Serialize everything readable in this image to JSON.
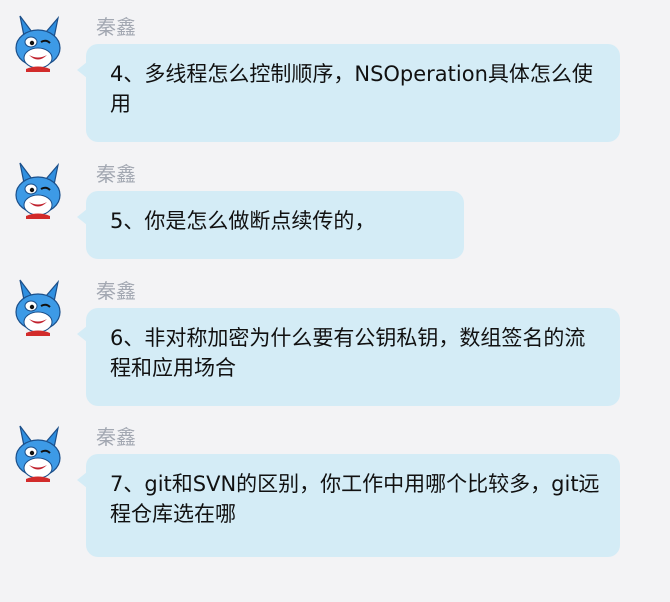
{
  "messages": [
    {
      "sender": "秦鑫",
      "text": "4、多线程怎么控制顺序，NSOperation具体怎么使用"
    },
    {
      "sender": "秦鑫",
      "text": "5、你是怎么做断点续传的，"
    },
    {
      "sender": "秦鑫",
      "text": "6、非对称加密为什么要有公钥私钥，数组签名的流程和应用场合"
    },
    {
      "sender": "秦鑫",
      "text": "7、git和SVN的区别，你工作中用哪个比较多，git远程仓库选在哪"
    }
  ],
  "colors": {
    "background": "#f3f3f5",
    "bubble": "#d4ecf6",
    "sender_name": "#a3a8b2",
    "message_text": "#111111",
    "avatar_blue": "#2f8fe0"
  },
  "icons": {
    "avatar": "cartoon-rabbit-avatar-icon"
  }
}
